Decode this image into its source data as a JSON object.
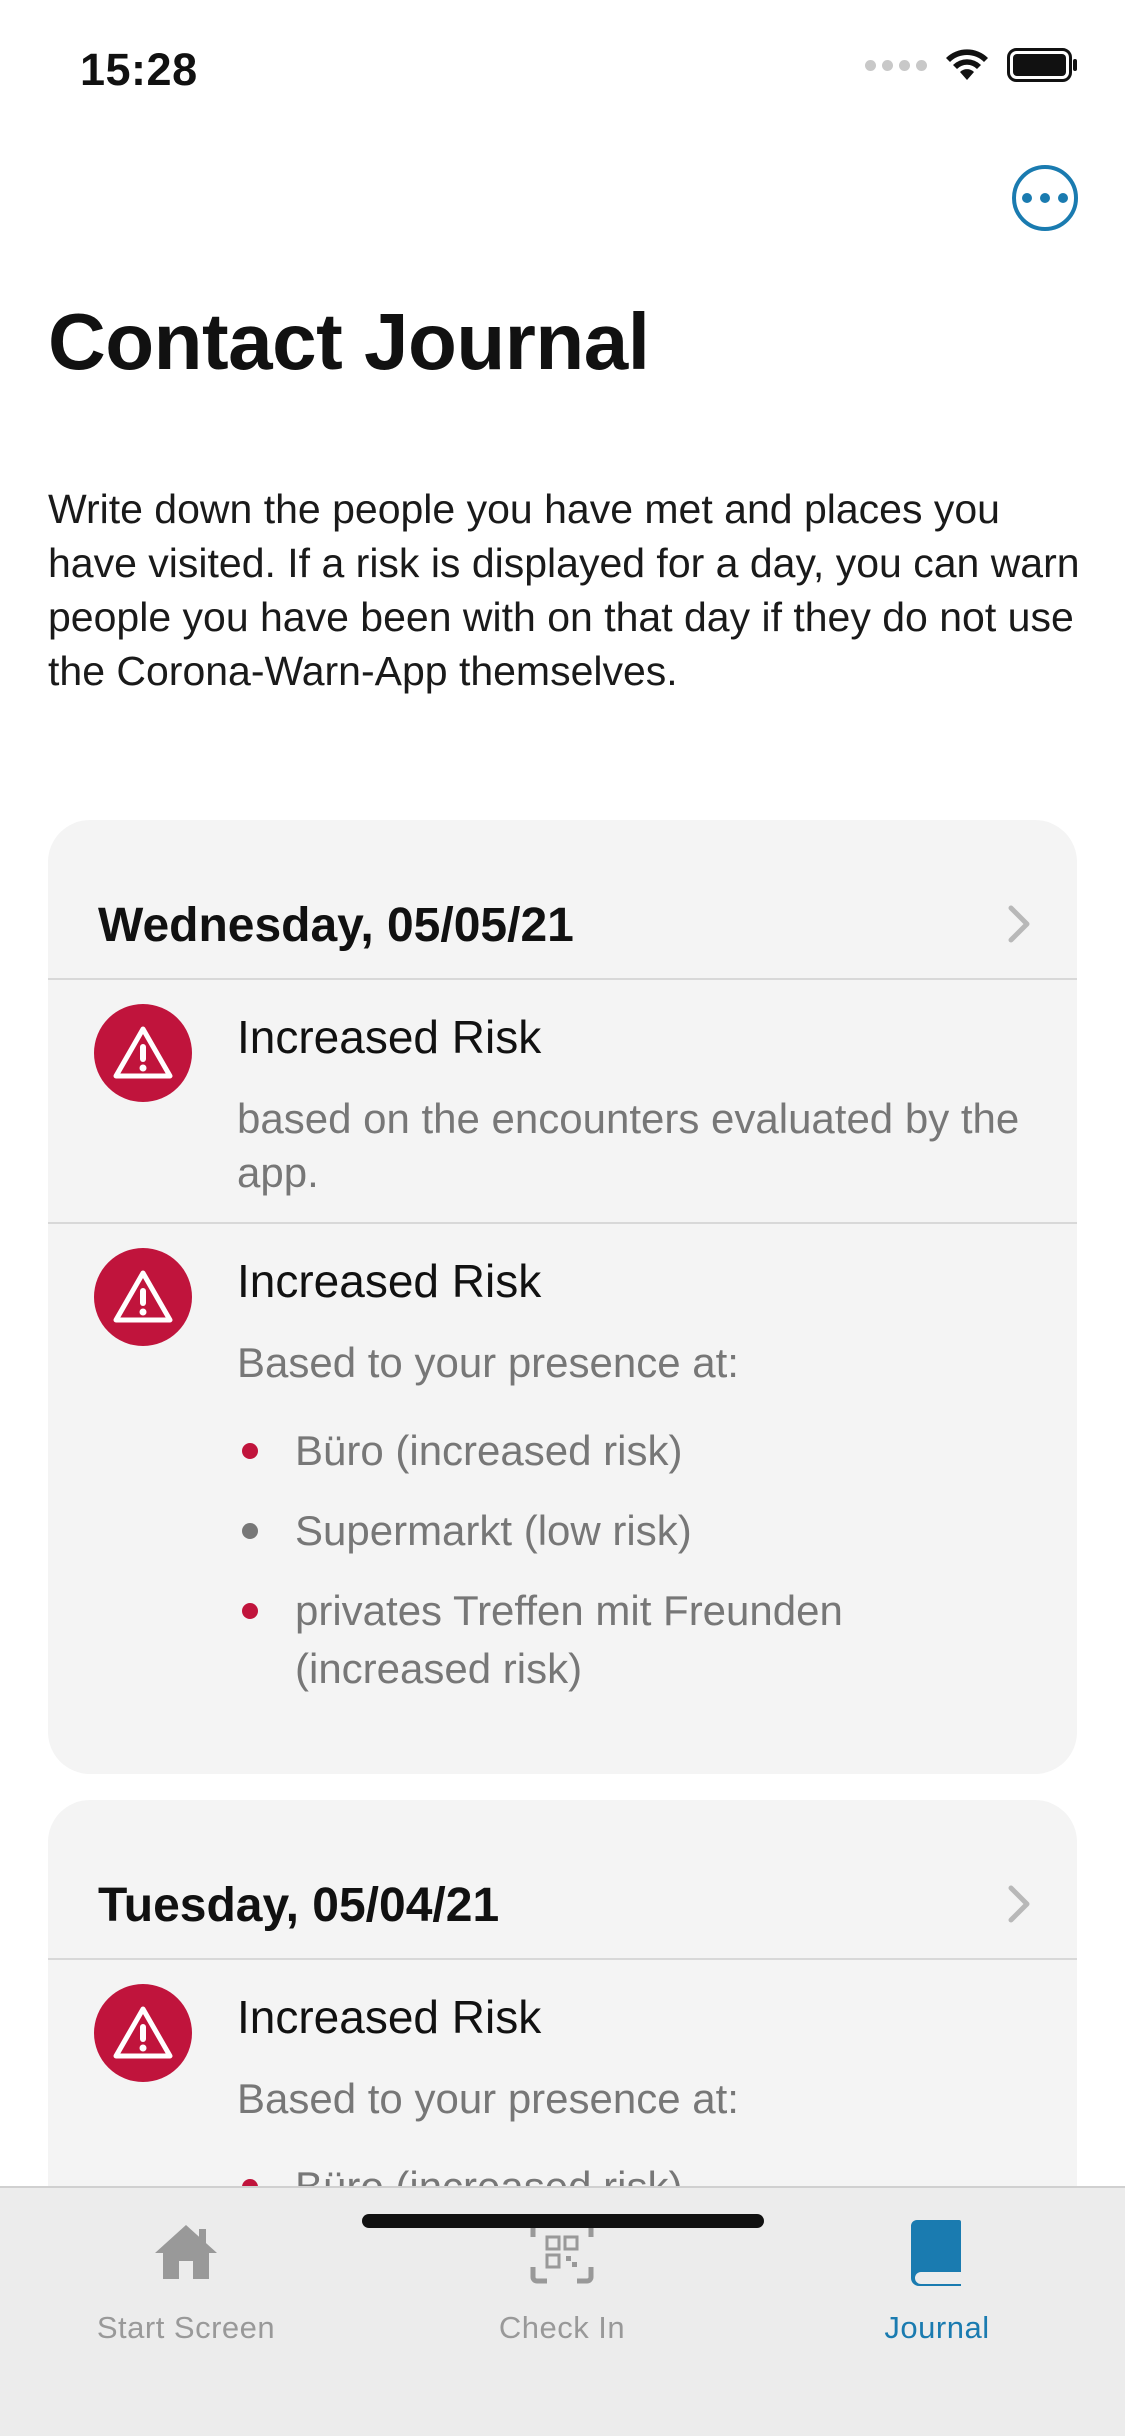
{
  "status_bar": {
    "time": "15:28"
  },
  "header": {
    "title": "Contact Journal",
    "more_icon": "ellipsis-circle-icon"
  },
  "intro": "Write down the people you have met and places you have visited. If a risk is displayed for a day, you can warn people you have been with on that day if they do not use the Corona-Warn-App themselves.",
  "days": [
    {
      "date": "Wednesday, 05/05/21",
      "risks": [
        {
          "title": "Increased Risk",
          "subtitle": "based on the encounters evaluated by the app."
        },
        {
          "title": "Increased Risk",
          "subtitle": "Based to your presence at:",
          "locations": [
            {
              "text": "Büro (increased risk)",
              "color": "#c0143c"
            },
            {
              "text": "Supermarkt (low risk)",
              "color": "#777777"
            },
            {
              "text": "privates Treffen mit Freunden (increased risk)",
              "color": "#c0143c"
            }
          ]
        }
      ]
    },
    {
      "date": "Tuesday, 05/04/21",
      "risks": [
        {
          "title": "Increased Risk",
          "subtitle": "Based to your presence at:",
          "locations": [
            {
              "text": "Büro (increased risk)",
              "color": "#c0143c"
            }
          ]
        }
      ]
    }
  ],
  "tab_bar": {
    "tabs": [
      {
        "label": "Start Screen",
        "icon": "home-icon",
        "active": false
      },
      {
        "label": "Check In",
        "icon": "qr-code-icon",
        "active": false
      },
      {
        "label": "Journal",
        "icon": "book-icon",
        "active": true
      }
    ]
  },
  "colors": {
    "accent": "#1a7bb0",
    "risk_high": "#c0143c",
    "risk_low": "#777777"
  }
}
